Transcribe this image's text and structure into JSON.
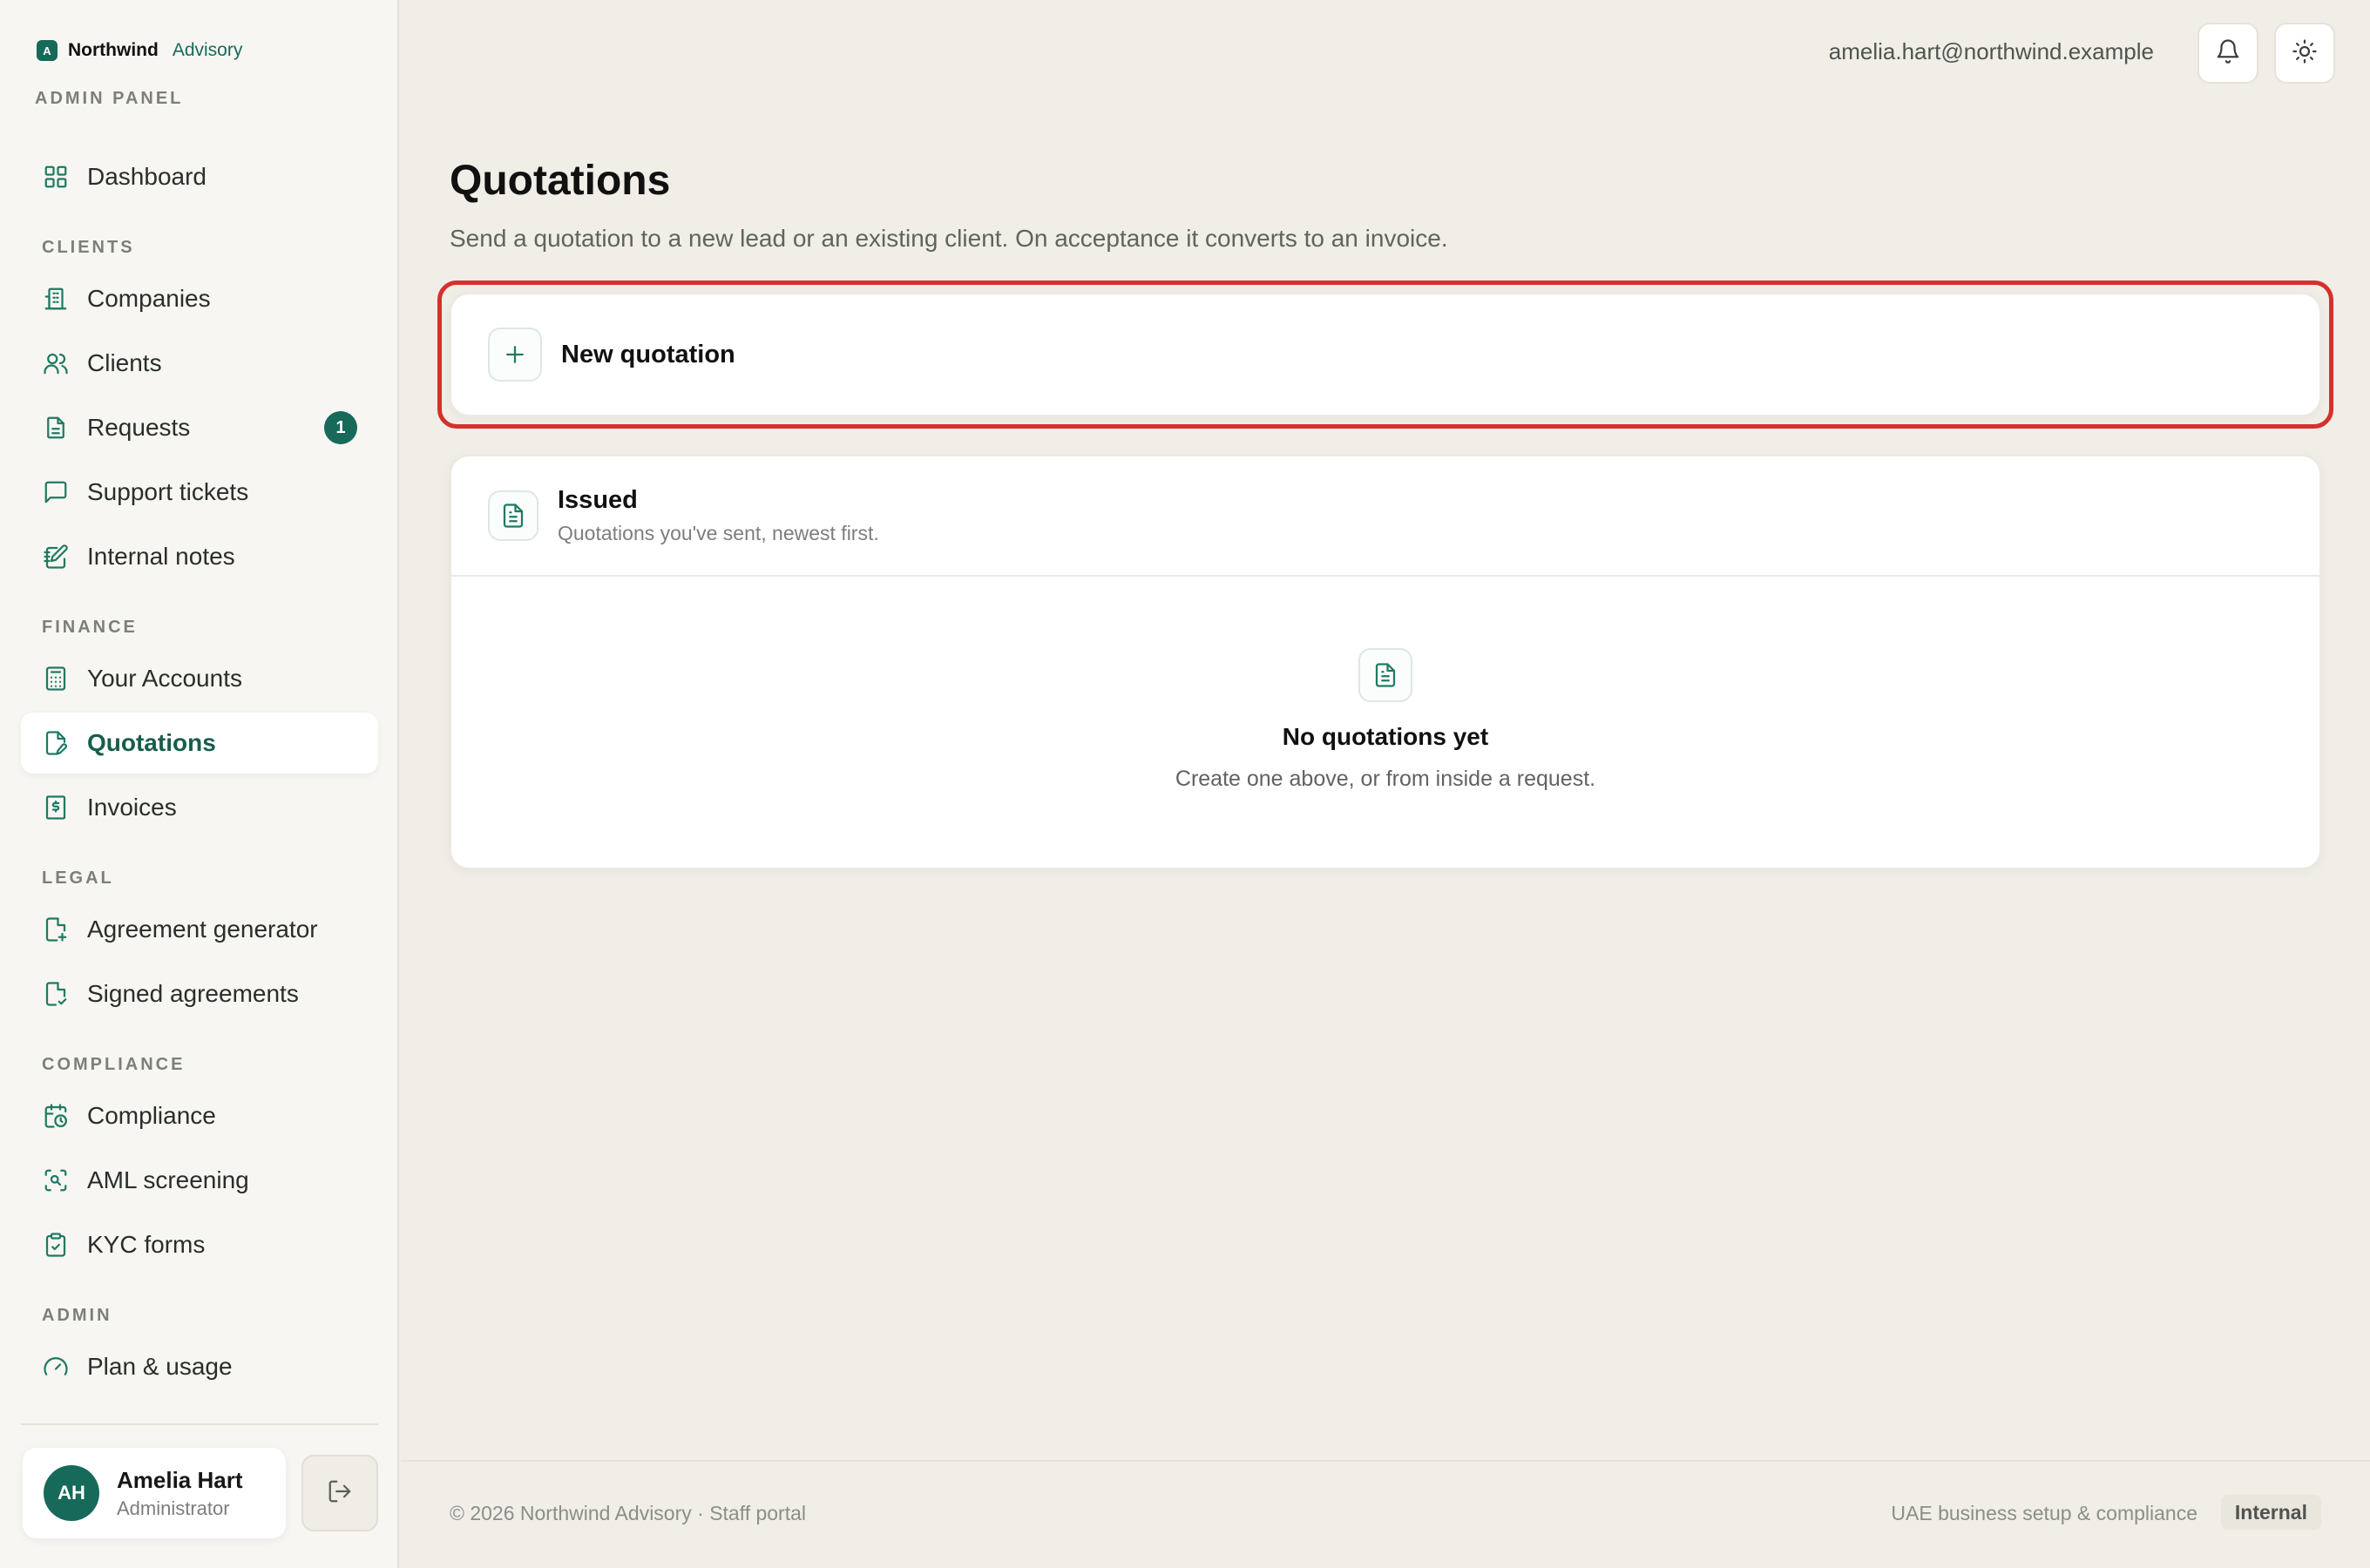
{
  "brand": {
    "logo_letter": "A",
    "name": "Northwind",
    "sub": "Advisory"
  },
  "panel_label": "ADMIN PANEL",
  "nav": {
    "dashboard": "Dashboard",
    "sections": {
      "clients": "CLIENTS",
      "finance": "FINANCE",
      "legal": "LEGAL",
      "compliance": "COMPLIANCE",
      "admin": "ADMIN"
    },
    "companies": "Companies",
    "clients": "Clients",
    "requests": "Requests",
    "requests_badge": "1",
    "support_tickets": "Support tickets",
    "internal_notes": "Internal notes",
    "your_accounts": "Your Accounts",
    "quotations": "Quotations",
    "invoices": "Invoices",
    "agreement_generator": "Agreement generator",
    "signed_agreements": "Signed agreements",
    "compliance": "Compliance",
    "aml_screening": "AML screening",
    "kyc_forms": "KYC forms",
    "plan_usage": "Plan & usage"
  },
  "user": {
    "initials": "AH",
    "name": "Amelia Hart",
    "role": "Administrator",
    "email": "amelia.hart@northwind.example"
  },
  "page": {
    "title": "Quotations",
    "description": "Send a quotation to a new lead or an existing client. On acceptance it converts to an invoice.",
    "new_quotation": "New quotation",
    "issued_title": "Issued",
    "issued_subtitle": "Quotations you've sent, newest first.",
    "empty_title": "No quotations yet",
    "empty_subtitle": "Create one above, or from inside a request."
  },
  "footer": {
    "left": "© 2026 Northwind Advisory · Staff portal",
    "right": "UAE business setup & compliance",
    "badge": "Internal"
  },
  "colors": {
    "accent": "#17695a",
    "highlight": "#d6302c",
    "background": "#f0eee7"
  }
}
